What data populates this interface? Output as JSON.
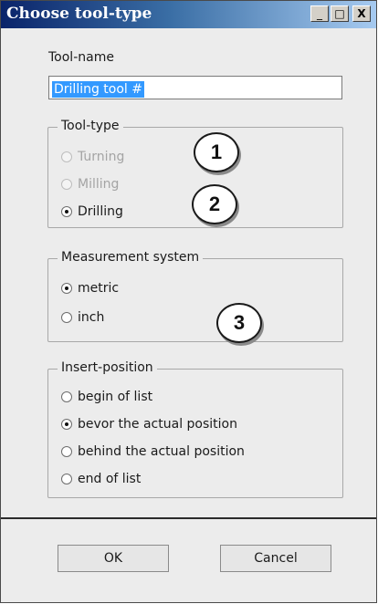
{
  "window": {
    "title": "Choose tool-type",
    "controls": {
      "minimize": "_",
      "maximize": "□",
      "close": "X"
    }
  },
  "tool_name": {
    "label": "Tool-name",
    "value": "Drilling tool #"
  },
  "tool_type": {
    "legend": "Tool-type",
    "options": [
      {
        "label": "Turning",
        "selected": false,
        "enabled": false
      },
      {
        "label": "Milling",
        "selected": false,
        "enabled": false
      },
      {
        "label": "Drilling",
        "selected": true,
        "enabled": true
      }
    ]
  },
  "measurement_system": {
    "legend": "Measurement system",
    "options": [
      {
        "label": "metric",
        "selected": true
      },
      {
        "label": "inch",
        "selected": false
      }
    ]
  },
  "insert_position": {
    "legend": "Insert-position",
    "options": [
      {
        "label": "begin of list",
        "selected": false
      },
      {
        "label": "bevor the actual position",
        "selected": true
      },
      {
        "label": "behind the actual position",
        "selected": false
      },
      {
        "label": "end of list",
        "selected": false
      }
    ]
  },
  "callouts": [
    "1",
    "2",
    "3"
  ],
  "buttons": {
    "ok": "OK",
    "cancel": "Cancel"
  },
  "colors": {
    "titlebar_start": "#0a246a",
    "titlebar_end": "#a6caf0",
    "selection": "#3399ff"
  }
}
